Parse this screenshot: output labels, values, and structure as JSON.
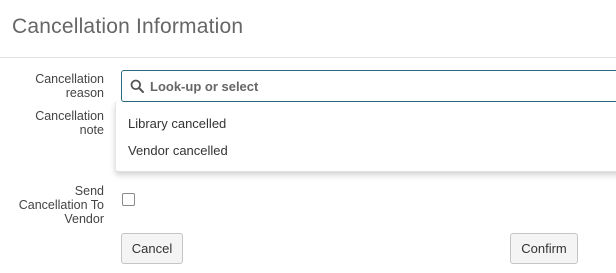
{
  "header": {
    "title": "Cancellation Information"
  },
  "form": {
    "cancellation_reason_label": "Cancellation reason",
    "cancellation_note_label": "Cancellation note",
    "send_to_vendor_label": "Send Cancellation To Vendor",
    "send_to_vendor_checked": false
  },
  "reason_select": {
    "placeholder": "Look-up or select",
    "value": "",
    "options": [
      "Library cancelled",
      "Vendor cancelled"
    ]
  },
  "actions": {
    "cancel_label": "Cancel",
    "confirm_label": "Confirm"
  },
  "colors": {
    "focus_border": "#2a6b80",
    "title_text": "#666666",
    "button_bg": "#f4f4f4"
  }
}
